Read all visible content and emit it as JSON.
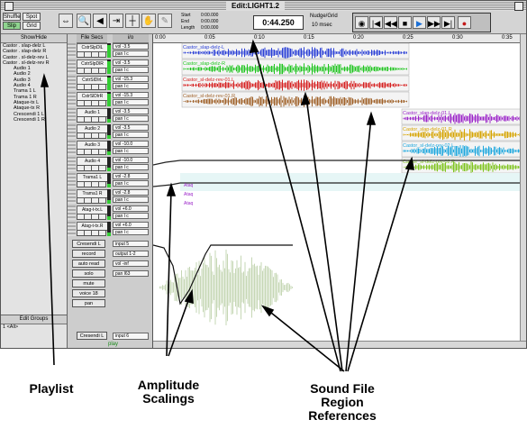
{
  "window": {
    "title": "Edit:LIGHT1.2"
  },
  "toolbar": {
    "mode_buttons": [
      "Shuffle",
      "Spot",
      "Slip",
      "Grid"
    ],
    "start_label": "Start",
    "start_value": "0:00.000",
    "end_label": "End",
    "end_value": "0:00.000",
    "length_label": "Length",
    "length_value": "0:00.000",
    "main_counter": "0:44.250",
    "nudge_label": "Nudge/Grid",
    "nudge_value": "10 msec"
  },
  "playlist": {
    "header": "Show/Hide",
    "items": [
      "Castor . slap-delz L",
      "Castor . slap-delz R",
      "Castor . sl-delz-rev L",
      "Castor . sl-delz-rev R",
      "Audio 1",
      "Audio 2",
      "Audio 3",
      "Audio 4",
      "Trama 1 L",
      "Trama 1 R",
      "Ataque-tx L",
      "Ataque-tx R",
      "Crescendi 1 L",
      "Crescendi 1 R"
    ]
  },
  "edit_groups": {
    "header": "Edit Groups",
    "item": "1 <All>"
  },
  "mix": {
    "header_name": "File Secs",
    "header_io": "i/o",
    "tracks": [
      {
        "name": "CstrSlpDlL",
        "io_a": "vol   -3.5",
        "io_b": "pan  l c"
      },
      {
        "name": "CstrSlpDlR",
        "io_a": "vol   -3.5",
        "io_b": "pan  l c"
      },
      {
        "name": "CstrSlDlrL",
        "io_a": "vol  -15.3",
        "io_b": "pan  l c"
      },
      {
        "name": "CstrSlDlrR",
        "io_a": "vol  -15.3",
        "io_b": "pan  l c"
      },
      {
        "name": "Audio 1",
        "io_a": "vol   -3.5",
        "io_b": "pan  l c"
      },
      {
        "name": "Audio 2",
        "io_a": "vol   -3.5",
        "io_b": "pan  l c"
      },
      {
        "name": "Audio 3",
        "io_a": "vol  -10.0",
        "io_b": "pan  l c"
      },
      {
        "name": "Audio 4",
        "io_a": "vol  -10.0",
        "io_b": "pan  l c"
      },
      {
        "name": "Trama1 L",
        "io_a": "vol   -2.8",
        "io_b": "pan  l c"
      },
      {
        "name": "Trama1 R",
        "io_a": "vol   -2.8",
        "io_b": "pan  l c"
      },
      {
        "name": "Atag-t-tx.L",
        "io_a": "vol   +6.0",
        "io_b": "pan  l c"
      },
      {
        "name": "Atag-t-tx.R",
        "io_a": "vol   +6.0",
        "io_b": "pan  l c"
      }
    ],
    "sends": [
      "Cresendi L",
      "record",
      "auto read",
      "solo",
      "mute",
      "voice 18",
      "pan"
    ],
    "sends_io": [
      "input 5",
      "output 1-2",
      "vol    -inf",
      "pan    l63"
    ],
    "bottom_track": "Cresendi L",
    "bottom_io": "input 6",
    "status": "play"
  },
  "ruler": {
    "ticks": [
      "0:00",
      "0:05",
      "0:10",
      "0:15",
      "0:20",
      "0:25",
      "0:30",
      "0:35"
    ]
  },
  "regions": [
    {
      "name": "Castor_slap-delz-L",
      "color": "#2a3fd6"
    },
    {
      "name": "Castor_slap-delz-R",
      "color": "#1fc51f"
    },
    {
      "name": "Castor_sl-delz-rev-01.L",
      "color": "#d62020"
    },
    {
      "name": "Castor_sl-delz-rev-01.R",
      "color": "#a0622a"
    },
    {
      "name": "Castor_slap-delz-01.L",
      "color": "#9b24c9"
    },
    {
      "name": "Castor_slap-delz-01.R",
      "color": "#d6a400"
    },
    {
      "name": "Castor_sl-delz-rev-02.L",
      "color": "#1ea7de"
    },
    {
      "name": "Castor_sl-delz-rev-02.R",
      "color": "#7fc41f"
    }
  ],
  "small_regions": [
    "Ataq",
    "Ataq",
    "Ataq"
  ],
  "annotations": {
    "playlist": "Playlist",
    "amplitude": "Amplitude Scalings",
    "sound_file": "Sound File Region References"
  }
}
